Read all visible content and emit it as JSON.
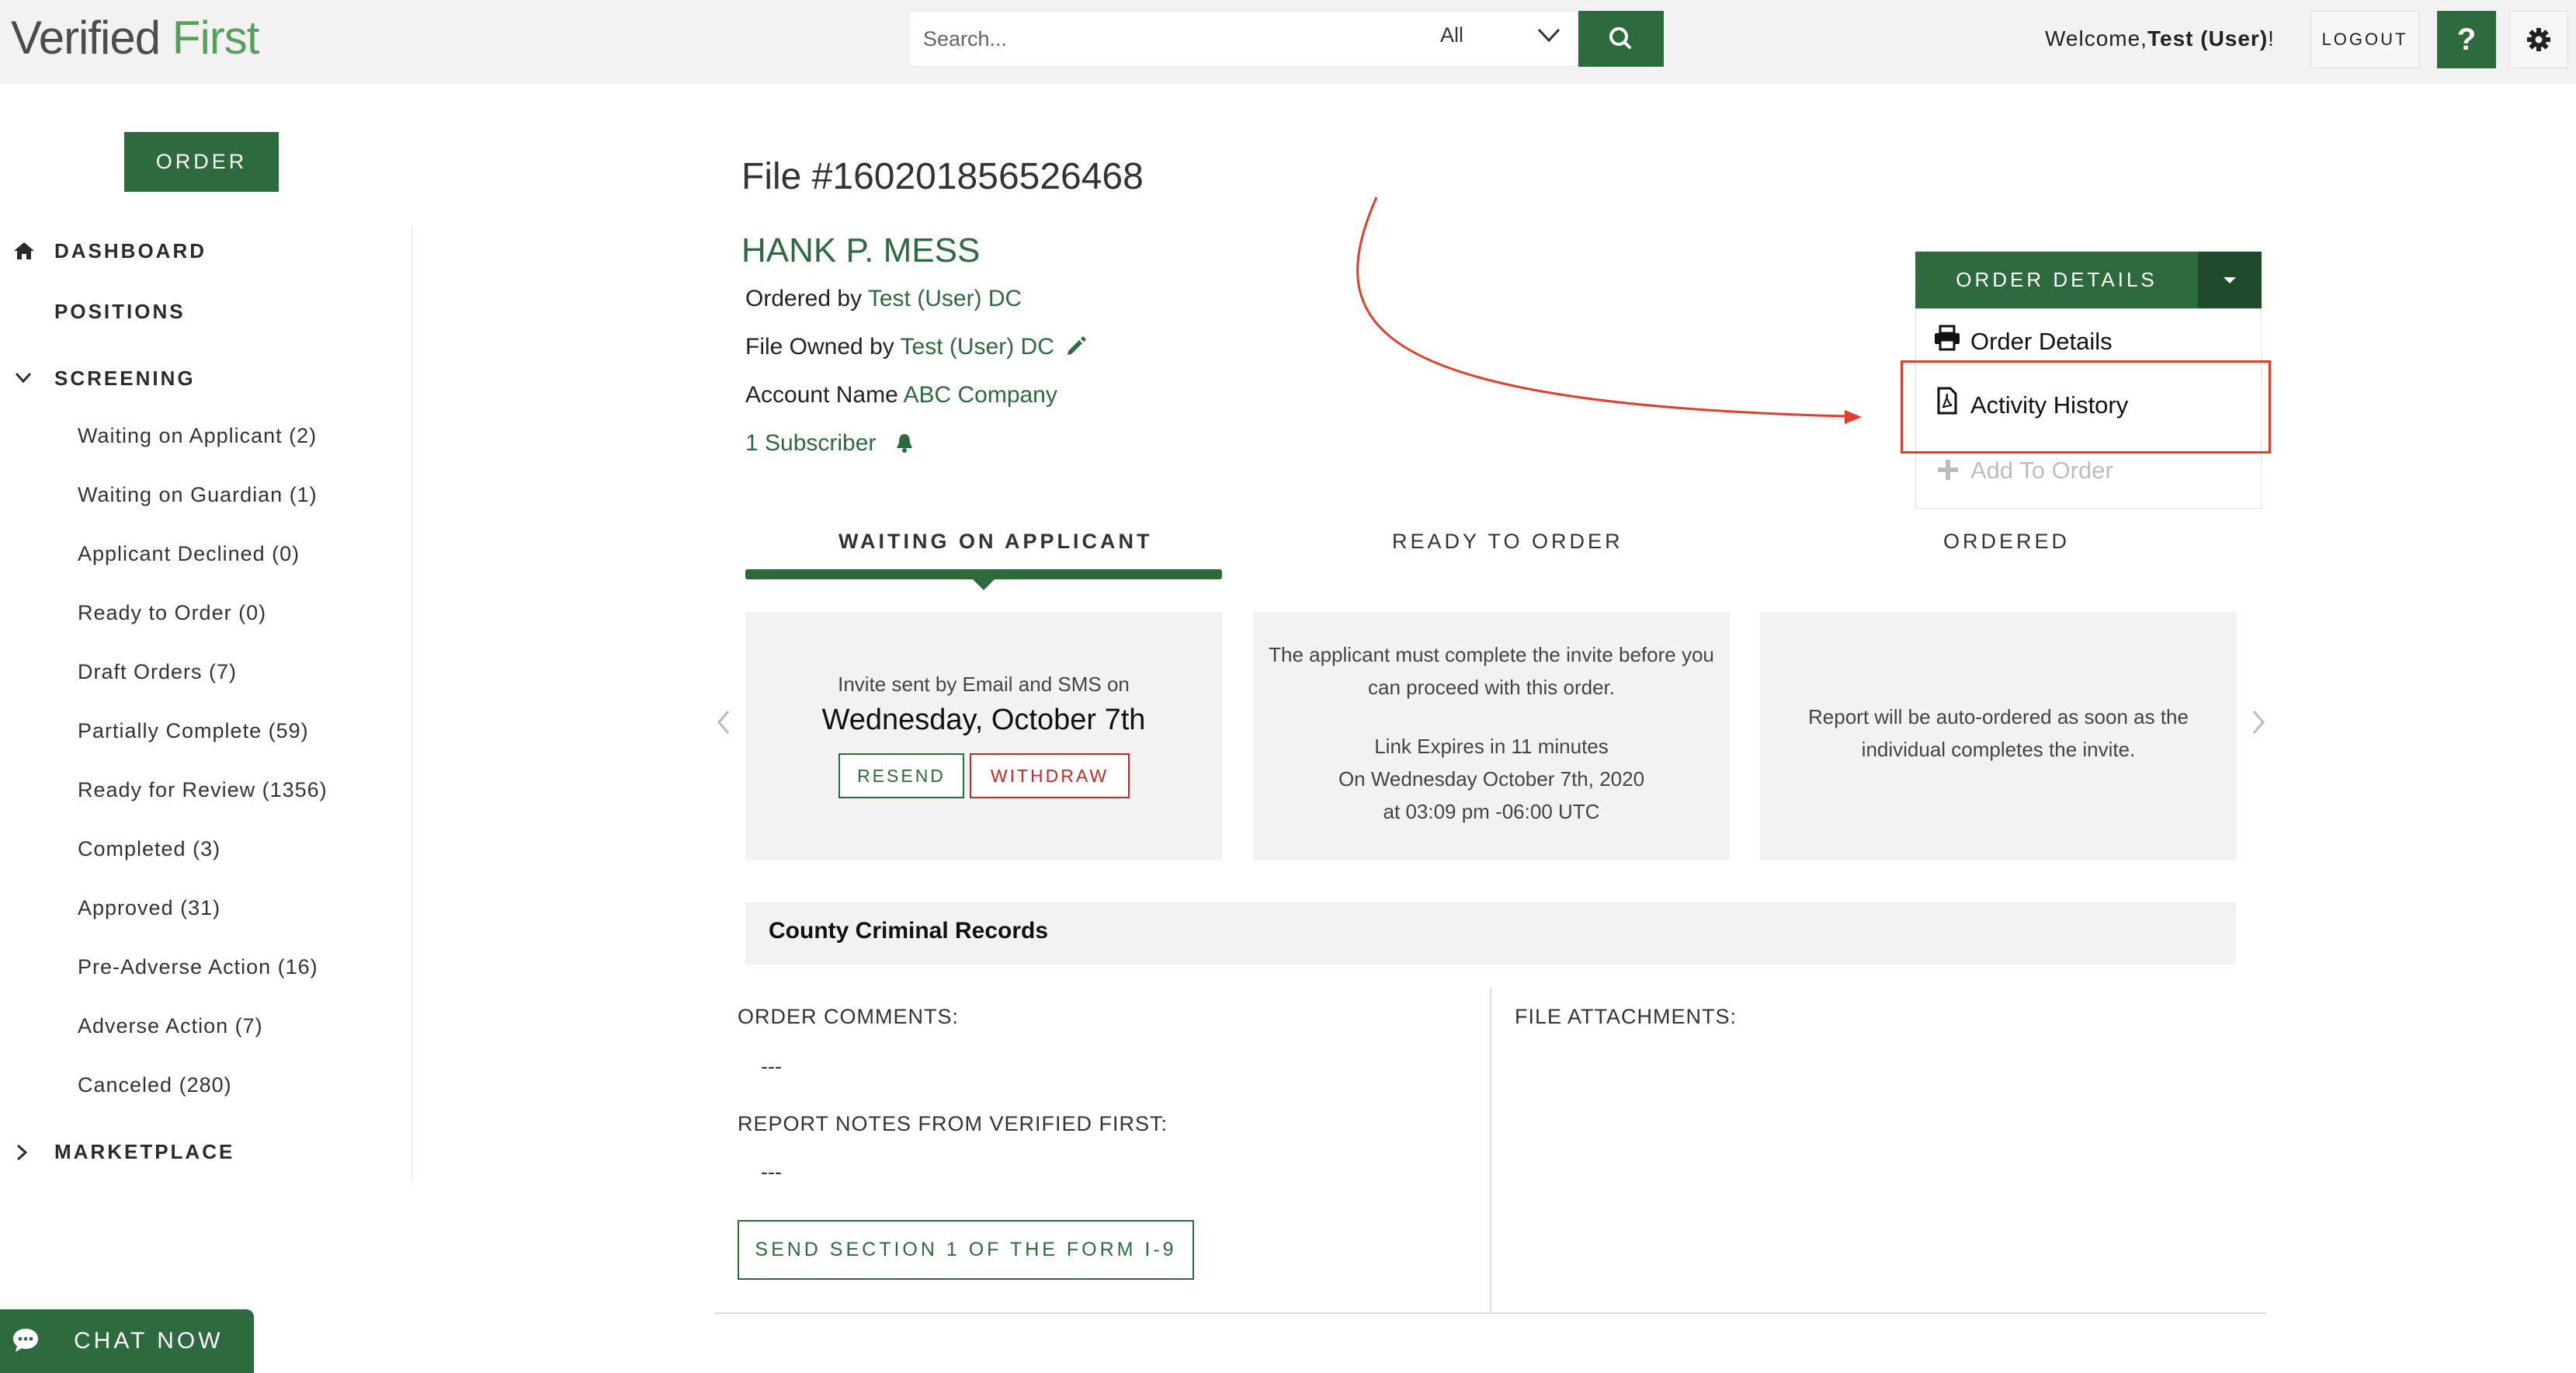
{
  "brand": {
    "logo_part1": "Verified",
    "logo_part2": " First"
  },
  "header": {
    "search_placeholder": "Search...",
    "search_filter": "All",
    "welcome_prefix": "Welcome,",
    "welcome_user": "Test (User)",
    "welcome_suffix": "!",
    "logout_label": "LOGOUT",
    "help_label": "?"
  },
  "sidebar": {
    "order_label": "ORDER",
    "dashboard_label": "DASHBOARD",
    "positions_label": "POSITIONS",
    "screening_label": "SCREENING",
    "marketplace_label": "MARKETPLACE",
    "screening_items": [
      "Waiting on Applicant (2)",
      "Waiting on Guardian (1)",
      "Applicant Declined (0)",
      "Ready to Order (0)",
      "Draft Orders (7)",
      "Partially Complete (59)",
      "Ready for Review (1356)",
      "Completed (3)",
      "Approved (31)",
      "Pre-Adverse Action (16)",
      "Adverse Action (7)",
      "Canceled (280)"
    ]
  },
  "file": {
    "title": "File #160201856526468",
    "applicant_name": "HANK P. MESS",
    "ordered_by_label": "Ordered by",
    "ordered_by_value": "Test (User) DC",
    "owned_by_label": "File Owned by",
    "owned_by_value": "Test (User) DC",
    "account_label": "Account Name",
    "account_value": "ABC Company",
    "subscriber_text": "1 Subscriber"
  },
  "order_menu": {
    "button_label": "ORDER DETAILS",
    "items": [
      "Order Details",
      "Activity History",
      "Add To Order"
    ]
  },
  "stages": {
    "labels": [
      "WAITING ON APPLICANT",
      "READY TO ORDER",
      "ORDERED"
    ],
    "waiting": {
      "line1": "Invite sent by Email and SMS on",
      "date": "Wednesday, October 7th",
      "resend_label": "RESEND",
      "withdraw_label": "WITHDRAW"
    },
    "ready": {
      "line1": "The applicant must complete the invite before you",
      "line2": "can proceed with this order.",
      "line3": "Link Expires in 11 minutes",
      "line4": "On Wednesday October 7th, 2020",
      "line5": "at 03:09 pm -06:00 UTC"
    },
    "ordered": {
      "line1": "Report will be auto-ordered as soon as the",
      "line2": "individual completes the invite."
    }
  },
  "county": {
    "title": "County Criminal Records"
  },
  "comments": {
    "order_comments_label": "ORDER COMMENTS:",
    "order_comments_value": "---",
    "report_notes_label": "REPORT NOTES FROM VERIFIED FIRST:",
    "report_notes_value": "---",
    "file_attachments_label": "FILE ATTACHMENTS:",
    "i9_button_label": "SEND SECTION 1 OF THE FORM I-9"
  },
  "chat": {
    "label": "CHAT NOW"
  },
  "colors": {
    "brand_green": "#2d6a3e",
    "highlight_red": "#e43d2a",
    "withdraw_red": "#c62828"
  }
}
